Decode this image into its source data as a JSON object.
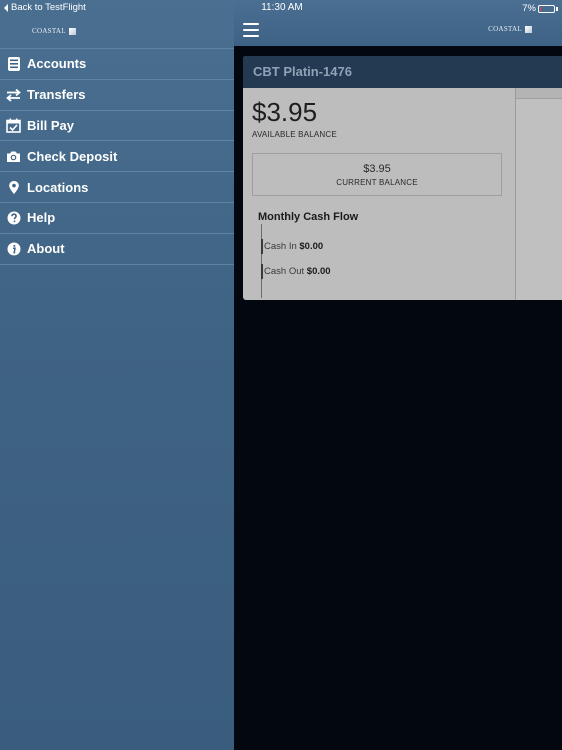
{
  "status_bar": {
    "back_label": "Back to TestFlight",
    "time": "11:30 AM",
    "battery": "7%"
  },
  "logo": {
    "text": "COASTAL"
  },
  "sidebar": {
    "items": [
      {
        "label": "Accounts",
        "icon": "accounts-icon"
      },
      {
        "label": "Transfers",
        "icon": "transfers-icon"
      },
      {
        "label": "Bill Pay",
        "icon": "calendar-check-icon"
      },
      {
        "label": "Check Deposit",
        "icon": "camera-icon"
      },
      {
        "label": "Locations",
        "icon": "location-pin-icon"
      },
      {
        "label": "Help",
        "icon": "help-icon"
      },
      {
        "label": "About",
        "icon": "info-icon"
      }
    ]
  },
  "account": {
    "name": "CBT Platin-1476",
    "available_balance": "$3.95",
    "available_label": "AVAILABLE BALANCE",
    "current_balance": "$3.95",
    "current_label": "CURRENT BALANCE"
  },
  "cash_flow": {
    "title": "Monthly Cash Flow",
    "cash_in_label": "Cash In",
    "cash_in_value": "$0.00",
    "cash_out_label": "Cash Out",
    "cash_out_value": "$0.00"
  },
  "colors": {
    "sidebar_bg": "#3f6383",
    "card_header": "#233a52",
    "card_bg": "#bdbdbd",
    "backdrop": "#03070f"
  }
}
